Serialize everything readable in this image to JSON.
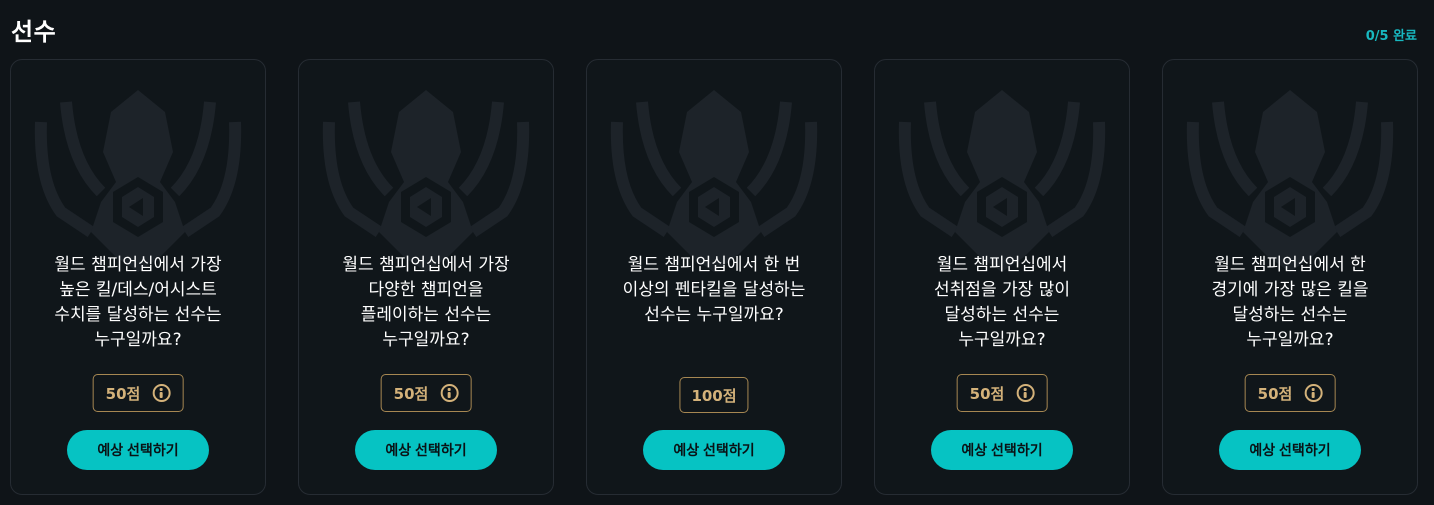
{
  "header": {
    "title": "선수",
    "progress": "0/5 완료"
  },
  "cards": [
    {
      "question": "월드 챔피언십에서 가장 높은 킬/데스/어시스트 수치를 달성하는 선수는 누구일까요?",
      "points": "50점",
      "has_info": true,
      "button": "예상 선택하기"
    },
    {
      "question": "월드 챔피언십에서 가장 다양한 챔피언을 플레이하는 선수는 누구일까요?",
      "points": "50점",
      "has_info": true,
      "button": "예상 선택하기"
    },
    {
      "question": "월드 챔피언십에서 한 번 이상의 펜타킬을 달성하는 선수는 누구일까요?",
      "points": "100점",
      "has_info": false,
      "button": "예상 선택하기"
    },
    {
      "question": "월드 챔피언십에서 선취점을 가장 많이 달성하는 선수는 누구일까요?",
      "points": "50점",
      "has_info": true,
      "button": "예상 선택하기"
    },
    {
      "question": "월드 챔피언십에서 한 경기에 가장 많은 킬을 달성하는 선수는 누구일까요?",
      "points": "50점",
      "has_info": true,
      "button": "예상 선택하기"
    }
  ],
  "colors": {
    "background": "#0f1418",
    "card_border": "#262c33",
    "accent": "#06c3c3",
    "gold": "#d4b27a",
    "progress": "#18b8c0"
  },
  "icons": {
    "emblem": "faded-champion-emblem-icon",
    "info": "info-icon"
  }
}
